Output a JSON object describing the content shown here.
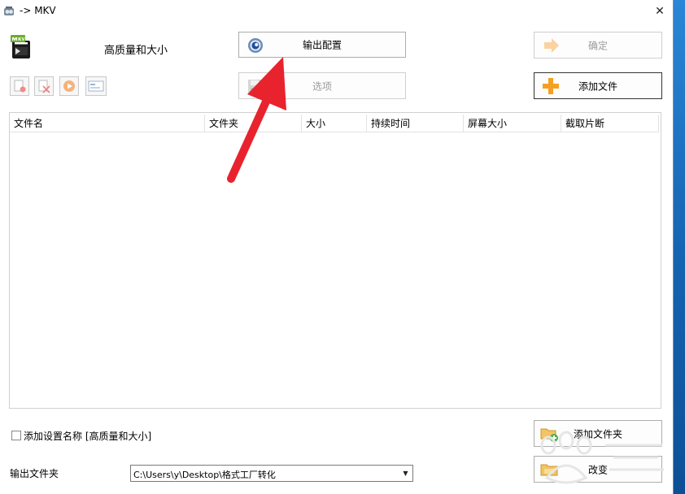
{
  "window": {
    "title": "-> MKV",
    "close_glyph": "✕"
  },
  "profile": {
    "label": "高质量和大小",
    "icon": "mkv-video-icon"
  },
  "buttons": {
    "output_config": "输出配置",
    "ok": "确定",
    "options": "选项",
    "add_file": "添加文件",
    "add_folder": "添加文件夹",
    "change": "改变"
  },
  "toolbar_icons": [
    "remove-icon",
    "clear-icon",
    "play-icon",
    "media-info-icon"
  ],
  "file_list": {
    "columns": [
      "文件名",
      "文件夹",
      "大小",
      "持续时间",
      "屏幕大小",
      "截取片断"
    ],
    "rows": []
  },
  "add_setting_name": {
    "label": "添加设置名称 [高质量和大小]",
    "checked": false
  },
  "output_folder": {
    "label": "输出文件夹",
    "value": "C:\\Users\\y\\Desktop\\格式工厂转化"
  },
  "colors": {
    "accent_orange": "#f5a020",
    "annotation_red": "#e8232d",
    "desktop_blue": "#1e6fb5"
  }
}
